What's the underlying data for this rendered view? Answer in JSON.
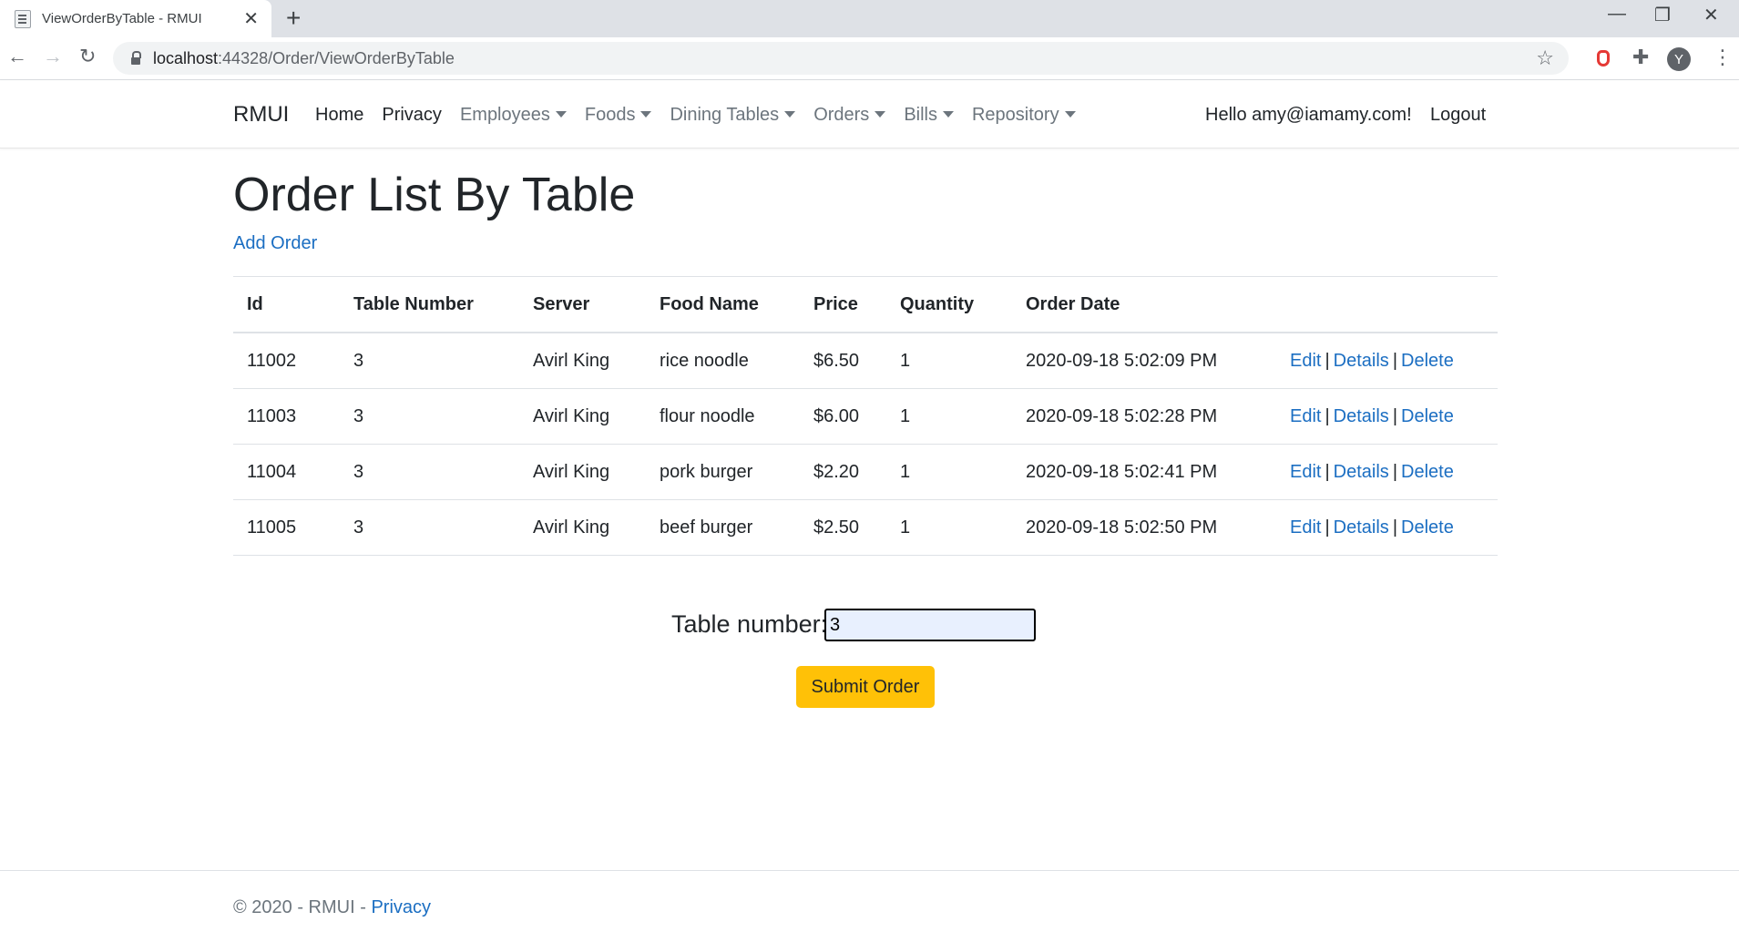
{
  "browser": {
    "tab_title": "ViewOrderByTable - RMUI",
    "tab_close": "✕",
    "new_tab": "+",
    "url_host": "localhost",
    "url_path": ":44328/Order/ViewOrderByTable",
    "avatar_letter": "Y"
  },
  "nav": {
    "brand": "RMUI",
    "links": [
      {
        "label": "Home"
      },
      {
        "label": "Privacy"
      },
      {
        "label": "Employees"
      },
      {
        "label": "Foods"
      },
      {
        "label": "Dining Tables"
      },
      {
        "label": "Orders"
      },
      {
        "label": "Bills"
      },
      {
        "label": "Repository"
      }
    ],
    "greeting": "Hello amy@iamamy.com!",
    "logout": "Logout"
  },
  "main": {
    "title": "Order List By Table",
    "add_link": "Add Order",
    "table": {
      "headers": [
        "Id",
        "Table Number",
        "Server",
        "Food Name",
        "Price",
        "Quantity",
        "Order Date",
        ""
      ],
      "rows": [
        {
          "id": "11002",
          "table": "3",
          "server": "Avirl King",
          "food": "rice noodle",
          "price": "$6.50",
          "qty": "1",
          "date": "2020-09-18 5:02:09 PM"
        },
        {
          "id": "11003",
          "table": "3",
          "server": "Avirl King",
          "food": "flour noodle",
          "price": "$6.00",
          "qty": "1",
          "date": "2020-09-18 5:02:28 PM"
        },
        {
          "id": "11004",
          "table": "3",
          "server": "Avirl King",
          "food": "pork burger",
          "price": "$2.20",
          "qty": "1",
          "date": "2020-09-18 5:02:41 PM"
        },
        {
          "id": "11005",
          "table": "3",
          "server": "Avirl King",
          "food": "beef burger",
          "price": "$2.50",
          "qty": "1",
          "date": "2020-09-18 5:02:50 PM"
        }
      ],
      "actions": {
        "edit": "Edit",
        "details": "Details",
        "delete": "Delete",
        "separator": "|"
      }
    },
    "form": {
      "label": "Table number:",
      "value": "3",
      "submit": "Submit Order"
    }
  },
  "footer": {
    "text": "© 2020 - RMUI - ",
    "link": "Privacy"
  },
  "colors": {
    "link": "#1b6ec2",
    "submit_bg": "#ffc107",
    "nav_muted": "#6c757d",
    "input_bg": "#e8f0fe"
  }
}
